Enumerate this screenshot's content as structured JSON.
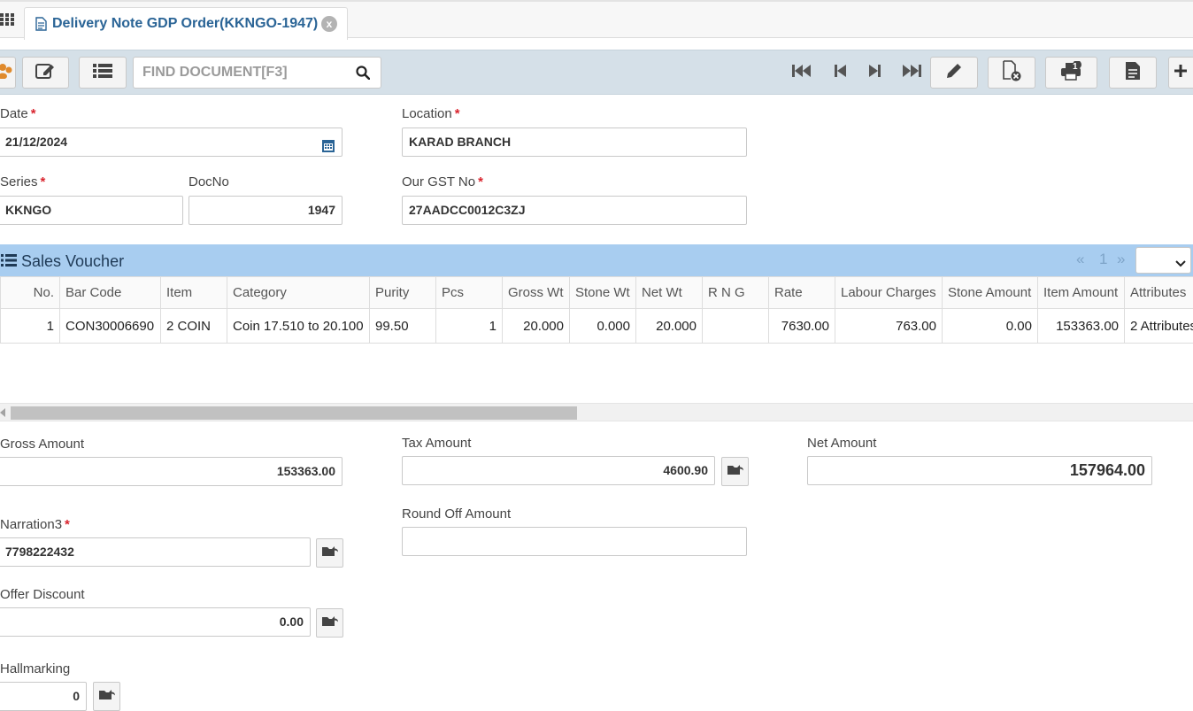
{
  "tab": {
    "title": "Delivery Note GDP Order(KKNGO-1947)",
    "close_symbol": "x"
  },
  "toolbar": {
    "find_placeholder": "FIND DOCUMENT[F3]",
    "print_badge": "1"
  },
  "form": {
    "date": {
      "label": "Date",
      "value": "21/12/2024"
    },
    "location": {
      "label": "Location",
      "value": "KARAD BRANCH"
    },
    "series": {
      "label": "Series",
      "value": "KKNGO"
    },
    "docno": {
      "label": "DocNo",
      "value": "1947"
    },
    "gst": {
      "label": "Our GST No",
      "value": "27AADCC0012C3ZJ"
    }
  },
  "sales_voucher": {
    "title": "Sales Voucher",
    "pager": {
      "prev": "«",
      "page": "1",
      "next": "»"
    },
    "columns": [
      "No.",
      "Bar Code",
      "Item",
      "Category",
      "Purity",
      "Pcs",
      "Gross Wt",
      "Stone Wt",
      "Net Wt",
      "R N G",
      "Rate",
      "Labour Charges",
      "Stone Amount",
      "Item Amount",
      "Attributes"
    ],
    "rows": [
      {
        "no": "1",
        "barcode": "CON30006690",
        "item": "2 COIN",
        "category": "Coin 17.510 to 20.100",
        "purity": "99.50",
        "pcs": "1",
        "gross_wt": "20.000",
        "stone_wt": "0.000",
        "net_wt": "20.000",
        "rng": "",
        "rate": "7630.00",
        "labour": "763.00",
        "stone_amount": "0.00",
        "item_amount": "153363.00",
        "attributes": "2 Attributes"
      }
    ]
  },
  "totals": {
    "gross_amount": {
      "label": "Gross Amount",
      "value": "153363.00"
    },
    "tax_amount": {
      "label": "Tax Amount",
      "value": "4600.90"
    },
    "net_amount": {
      "label": "Net Amount",
      "value": "157964.00"
    },
    "narration3": {
      "label": "Narration3",
      "value": "7798222432"
    },
    "round_off": {
      "label": "Round Off Amount",
      "value": ""
    },
    "offer_discount": {
      "label": "Offer Discount",
      "value": "0.00"
    },
    "hallmarking": {
      "label": "Hallmarking",
      "value": "0"
    }
  },
  "colors": {
    "accent": "#2a6496",
    "section_header": "#a8cdf0",
    "toolbar_bg": "#d5e0e8",
    "required": "#d9232d"
  },
  "icons": [
    "apps-grid-icon",
    "document-icon",
    "close-icon",
    "users-icon",
    "edit-icon",
    "list-icon",
    "search-icon",
    "first-page-icon",
    "prev-page-icon",
    "next-page-icon",
    "last-page-icon",
    "pencil-icon",
    "delete-doc-icon",
    "print-icon",
    "report-icon",
    "add-icon",
    "calendar-icon",
    "folder-share-icon"
  ]
}
